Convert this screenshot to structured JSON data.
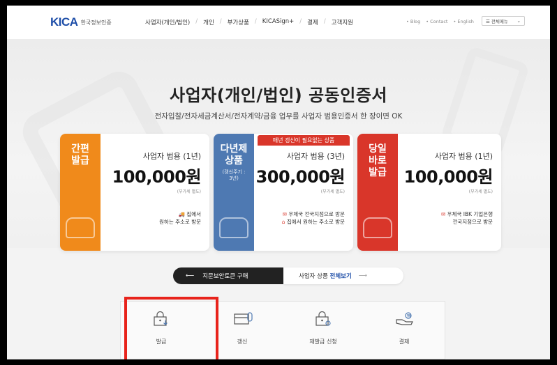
{
  "header": {
    "logo_mark": "KICA",
    "logo_text": "한국정보인증",
    "nav": [
      "사업자(개인/법인)",
      "개인",
      "부가상품",
      "KICASign+",
      "결제",
      "고객지원"
    ],
    "util": [
      "• Blog",
      "• Contact",
      "• English"
    ],
    "lang_select": "☰ 전체메뉴"
  },
  "hero": {
    "title": "사업자(개인/법인) 공동인증서",
    "subtitle": "전자입찰/전자세금계산서/전자계약/금융 업무를 사업자 범용인증서 한 장이면 OK"
  },
  "cards": [
    {
      "tag": "간편\n발급",
      "small": "",
      "line1": "사업자 범용 (1년)",
      "price": "100,000원",
      "vat": "(부가세 별도)",
      "note_line1": "집에서",
      "note_line2": "원하는 주소로 방문"
    },
    {
      "tag": "다년제\n상품",
      "small": "(갱신주기 :\n3년)",
      "line1": "사업자 범용 (3년)",
      "price": "300,000원",
      "vat": "(부가세 별도)",
      "note_line1": "우체국 전국지점으로 방문",
      "note_line2": "집에서 원하는 주소로 방문"
    },
    {
      "tag": "당일\n바로\n발급",
      "small": "",
      "line1": "사업자 범용 (1년)",
      "price": "100,000원",
      "vat": "(부가세 별도)",
      "note_line1": "우체국 IBK 기업은행",
      "note_line2": "전국지점으로 방문"
    }
  ],
  "badge": "매년 갱신이 필요없는 상품",
  "buttons": {
    "dark": "지문보안토큰 구매",
    "light_prefix": "사업자 상품",
    "light_bold": "전체보기"
  },
  "menu": [
    "발급",
    "갱신",
    "재발급 신청",
    "결제"
  ],
  "colors": {
    "orange": "#f08a1b",
    "blue": "#4e79b2",
    "red": "#d9362a",
    "highlight": "#e8231b"
  }
}
